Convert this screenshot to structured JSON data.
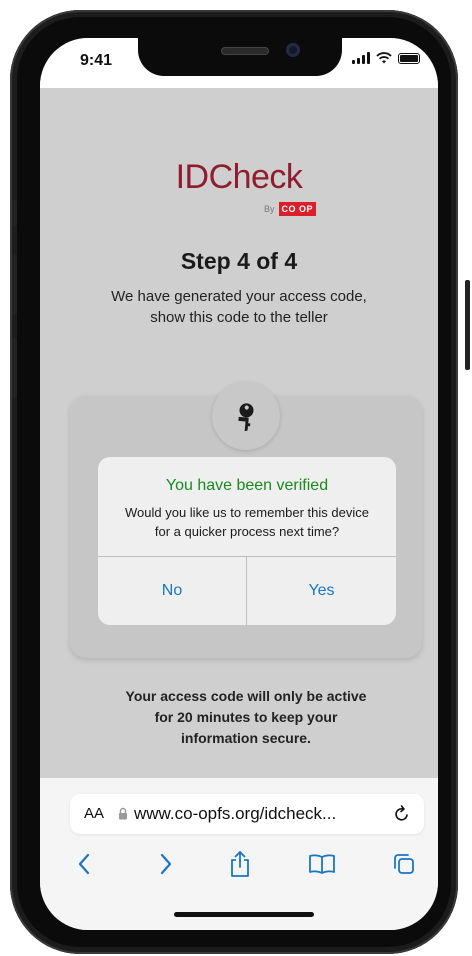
{
  "status": {
    "time": "9:41"
  },
  "logo": {
    "brand": "IDCheck",
    "by": "By",
    "coop": "CO OP"
  },
  "step": {
    "title": "Step 4 of 4",
    "description": "We have generated your access code, show this code to the teller"
  },
  "dialog": {
    "title": "You have been verified",
    "message": "Would you like us to remember this device for a quicker process next time?",
    "no_label": "No",
    "yes_label": "Yes"
  },
  "footer": {
    "note": "Your access code will only be active for 20 minutes to keep your information secure."
  },
  "browser": {
    "text_size_label": "AA",
    "url": "www.co-opfs.org/idcheck..."
  },
  "colors": {
    "brand": "#8f1c2f",
    "coop_red": "#d81f2a",
    "verified_green": "#1a8a1e",
    "link_blue": "#1877c4"
  },
  "icons": {
    "key": "key-icon",
    "lock": "lock-icon",
    "reload": "reload-icon",
    "back": "chevron-left-icon",
    "forward": "chevron-right-icon",
    "share": "share-icon",
    "bookmarks": "book-icon",
    "tabs": "tabs-icon"
  }
}
